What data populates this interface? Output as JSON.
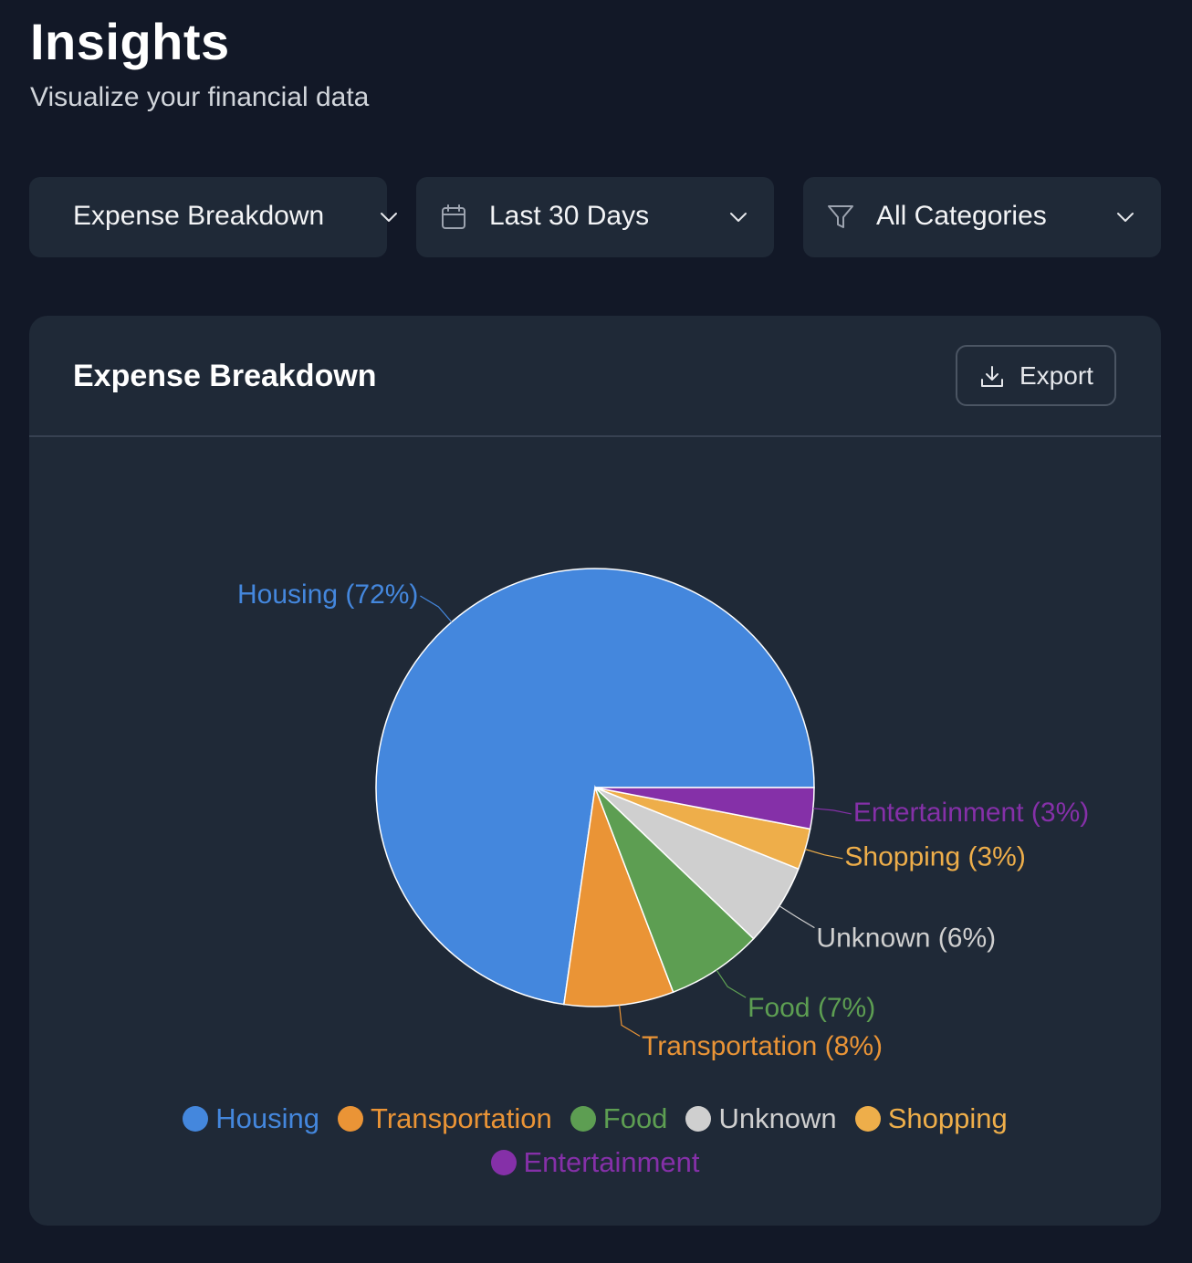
{
  "header": {
    "title": "Insights",
    "subtitle": "Visualize your financial data"
  },
  "controls": {
    "report_type": {
      "label": "Expense Breakdown",
      "icon": "chevron-down-icon"
    },
    "date_range": {
      "label": "Last 30 Days",
      "lead_icon": "calendar-icon",
      "icon": "chevron-down-icon"
    },
    "category": {
      "label": "All Categories",
      "lead_icon": "filter-icon",
      "icon": "chevron-down-icon"
    }
  },
  "card": {
    "title": "Expense Breakdown",
    "export_label": "Export",
    "export_icon": "download-icon"
  },
  "colors": {
    "background": "#121827",
    "surface": "#1f2937",
    "border": "#374151"
  },
  "chart_data": {
    "type": "pie",
    "title": "",
    "categories": [
      "Housing",
      "Transportation",
      "Food",
      "Unknown",
      "Shopping",
      "Entertainment"
    ],
    "values": [
      72,
      8,
      7,
      6,
      3,
      3
    ],
    "labels": [
      "Housing (72%)",
      "Transportation (8%)",
      "Food (7%)",
      "Unknown (6%)",
      "Shopping (3%)",
      "Entertainment (3%)"
    ],
    "colors": [
      "#4487DD",
      "#EA9436",
      "#5D9E52",
      "#CFCFCF",
      "#EEAE4A",
      "#8530A8"
    ],
    "legend_position": "bottom"
  }
}
